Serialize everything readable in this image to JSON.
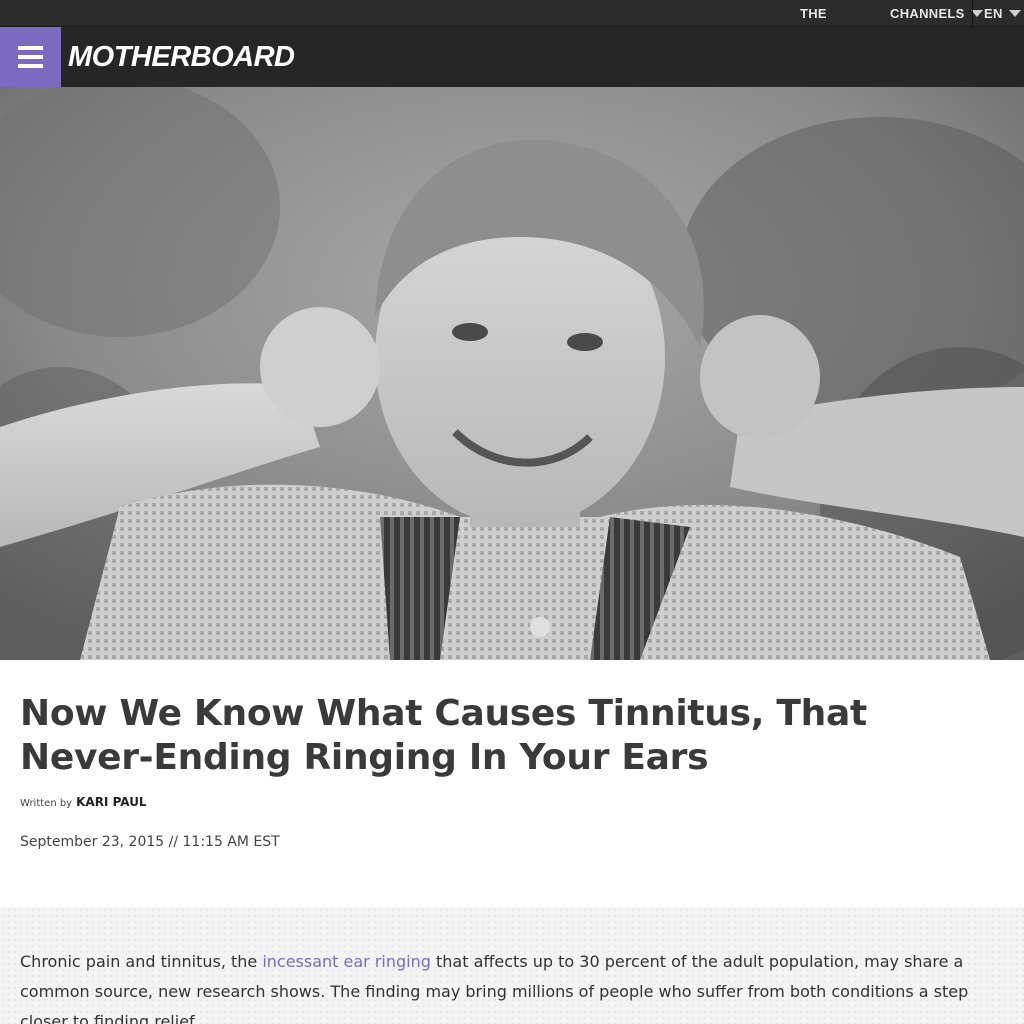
{
  "topbar": {
    "the_label": "THE",
    "channels_label": "CHANNELS",
    "language_label": "EN"
  },
  "header": {
    "logo_text": "MOTHERBOARD",
    "menu_icon": "hamburger-icon",
    "accent_color": "#7a6bc0"
  },
  "article": {
    "title": "Now We Know What Causes Tinnitus, That Never-Ending Ringing In Your Ears",
    "byline_label": "Written by",
    "author": "KARI PAUL",
    "date": "September 23, 2015 // 11:15 AM EST",
    "lead": {
      "before_link": "Chronic pain and tinnitus, the ",
      "link_text": "incessant ear ringing",
      "after_link": " that affects up to 30 percent of the adult population, may share a common source, new research shows. The finding may bring millions of people who suffer from both conditions a step closer to finding relief."
    }
  }
}
